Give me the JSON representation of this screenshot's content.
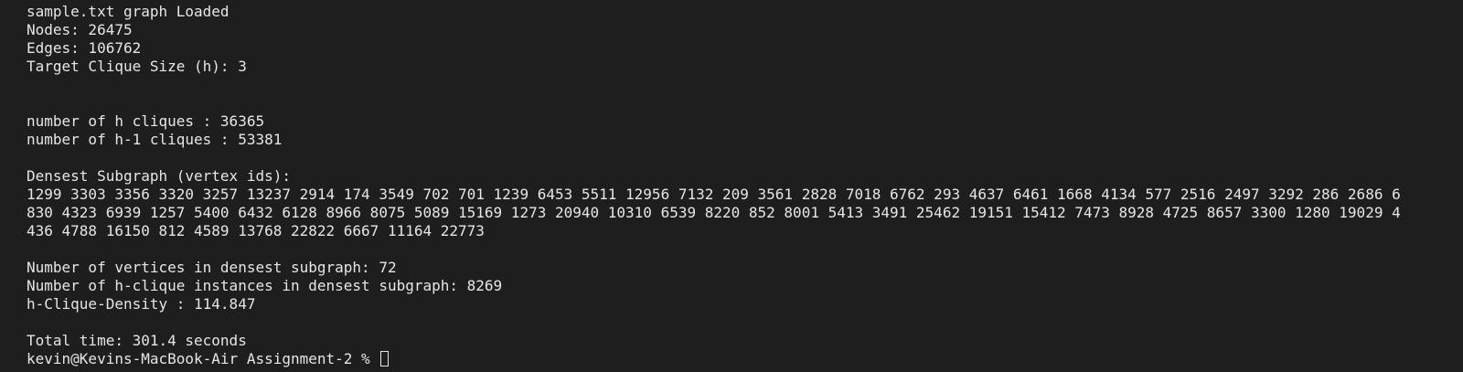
{
  "terminal": {
    "load": {
      "loaded": "sample.txt graph Loaded",
      "nodes": "Nodes: 26475",
      "edges": "Edges: 106762",
      "target": "Target Clique Size (h): 3"
    },
    "cliques": {
      "h": "number of h cliques : 36365",
      "h_minus_1": "number of h-1 cliques : 53381"
    },
    "densest": {
      "header": "Densest Subgraph (vertex ids):",
      "rows": [
        "1299 3303 3356 3320 3257 13237 2914 174 3549 702 701 1239 6453 5511 12956 7132 209 3561 2828 7018 6762 293 4637 6461 1668 4134 577 2516 2497 3292 286 2686 6",
        "830 4323 6939 1257 5400 6432 6128 8966 8075 5089 15169 1273 20940 10310 6539 8220 852 8001 5413 3491 25462 19151 15412 7473 8928 4725 8657 3300 1280 19029 4",
        "436 4788 16150 812 4589 13768 22822 6667 11164 22773"
      ]
    },
    "results": {
      "vertices": "Number of vertices in densest subgraph: 72",
      "instances": "Number of h-clique instances in densest subgraph: 8269",
      "density": "h-Clique-Density : 114.847"
    },
    "total_time": "Total time: 301.4 seconds",
    "prompt": "kevin@Kevins-MacBook-Air Assignment-2 % "
  }
}
